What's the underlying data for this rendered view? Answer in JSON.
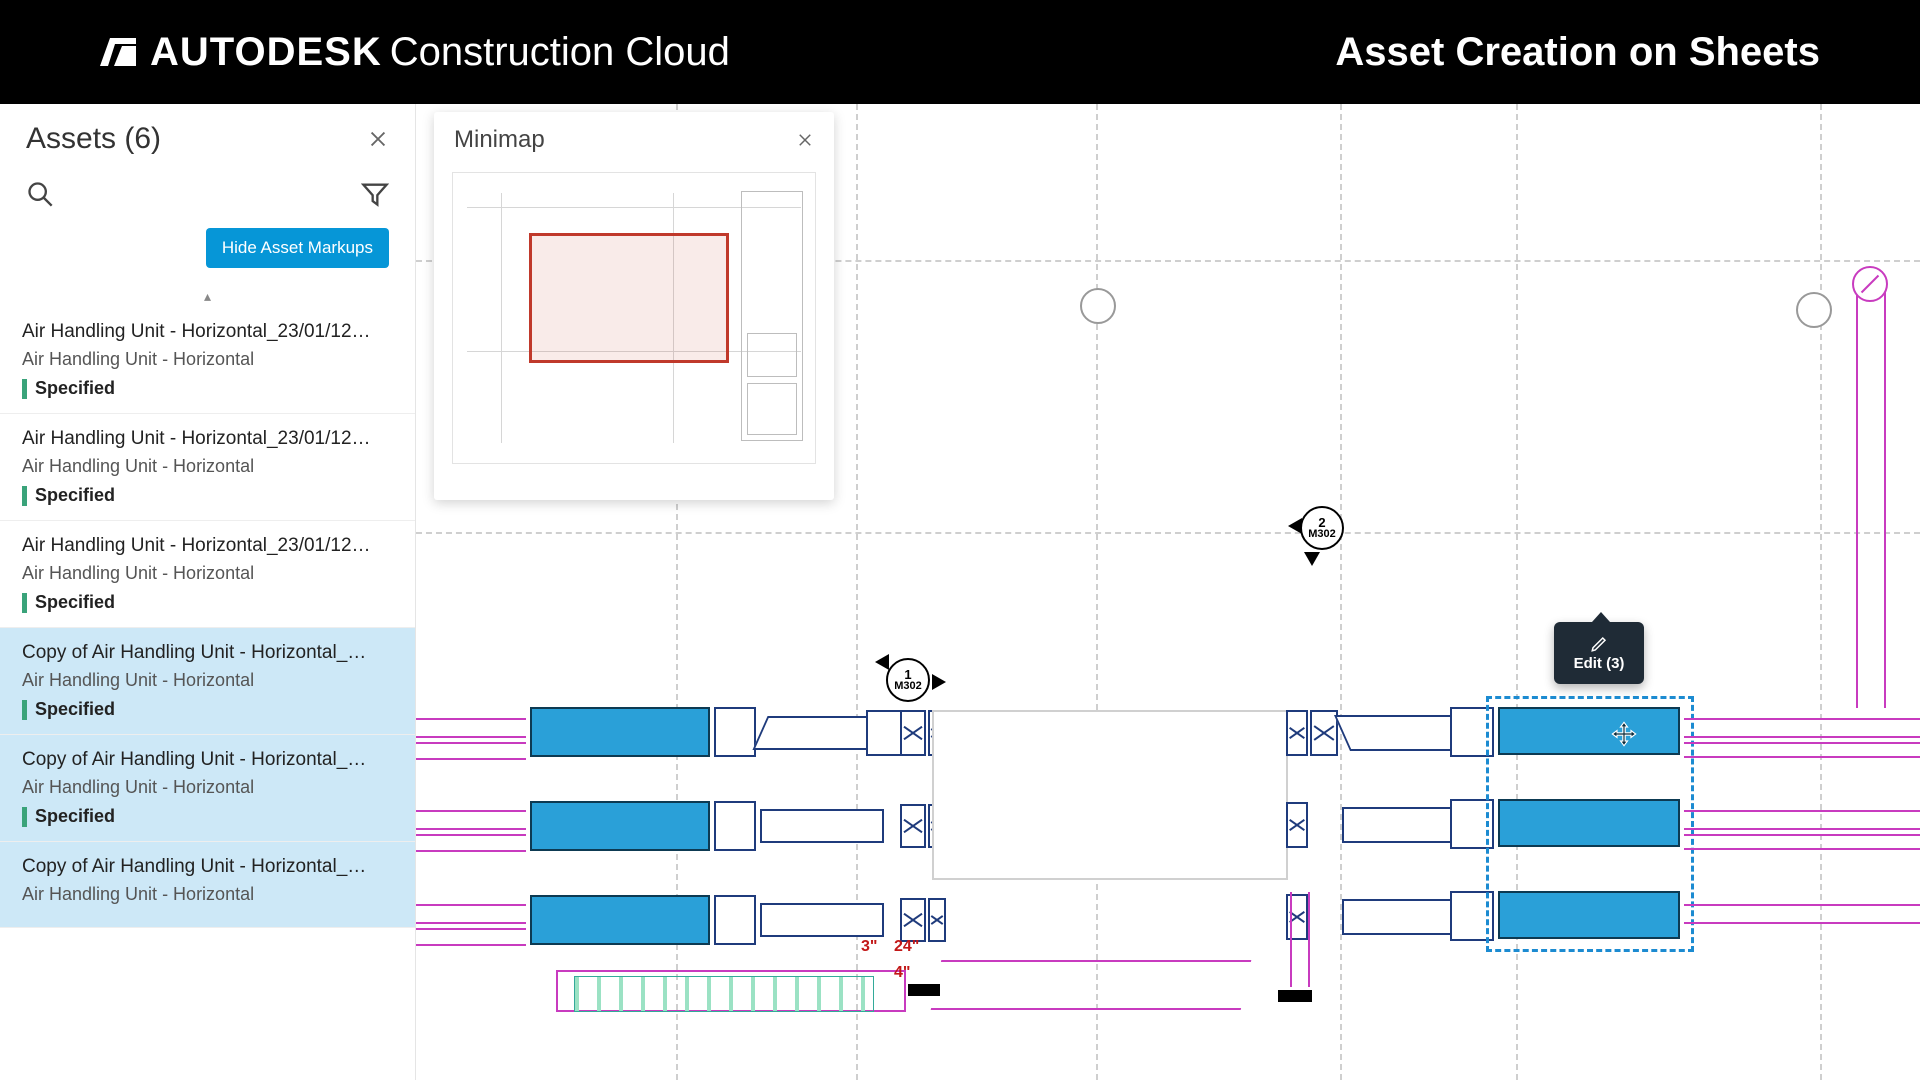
{
  "banner": {
    "brand_main": "AUTODESK",
    "brand_sub": "Construction Cloud",
    "right_title": "Asset Creation on Sheets"
  },
  "sidebar": {
    "title": "Assets (6)",
    "hide_markups_label": "Hide Asset Markups",
    "items": [
      {
        "title": "Air Handling Unit - Horizontal_23/01/12…",
        "subtitle": "Air Handling Unit - Horizontal",
        "status": "Specified",
        "selected": false
      },
      {
        "title": "Air Handling Unit - Horizontal_23/01/12…",
        "subtitle": "Air Handling Unit - Horizontal",
        "status": "Specified",
        "selected": false
      },
      {
        "title": "Air Handling Unit - Horizontal_23/01/12…",
        "subtitle": "Air Handling Unit - Horizontal",
        "status": "Specified",
        "selected": false
      },
      {
        "title": "Copy of Air Handling Unit - Horizontal_…",
        "subtitle": "Air Handling Unit - Horizontal",
        "status": "Specified",
        "selected": true
      },
      {
        "title": "Copy of Air Handling Unit - Horizontal_…",
        "subtitle": "Air Handling Unit - Horizontal",
        "status": "Specified",
        "selected": true
      },
      {
        "title": "Copy of Air Handling Unit - Horizontal_…",
        "subtitle": "Air Handling Unit - Horizontal",
        "status": "",
        "selected": true
      }
    ]
  },
  "minimap": {
    "title": "Minimap"
  },
  "canvas": {
    "callouts": [
      {
        "num": "1",
        "sheet": "M302"
      },
      {
        "num": "2",
        "sheet": "M302"
      }
    ],
    "dim_labels": {
      "a": "3\"",
      "b": "24\"",
      "c": "4\""
    },
    "edit_popup": "Edit (3)"
  },
  "colors": {
    "accent": "#0696d7",
    "status_green": "#3aa37a",
    "select_blue": "#1c8bd1"
  }
}
